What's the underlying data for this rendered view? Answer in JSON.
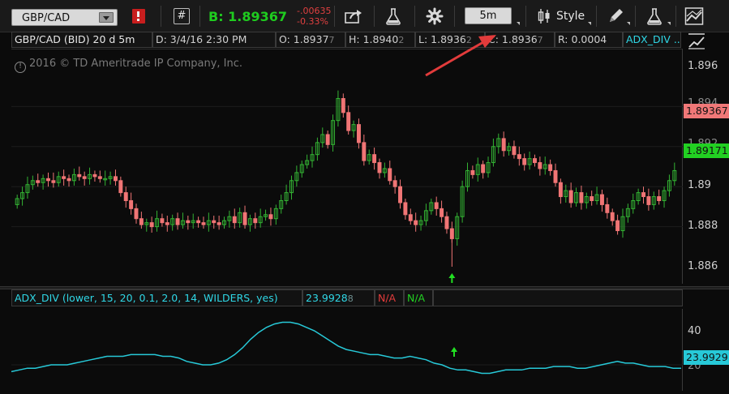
{
  "toolbar": {
    "symbol": "GBP/CAD",
    "bid": "B: 1.89367",
    "change_abs": "-.00635",
    "change_pct": "-0.33%",
    "timeframe": "5m",
    "style_label": "Style"
  },
  "infobar": {
    "title": "GBP/CAD (BID) 20 d 5m",
    "date": "D: 3/4/16 2:30 PM",
    "open": "O: 1.8937",
    "open_extra": "7",
    "high": "H: 1.8940",
    "high_extra": "2",
    "low": "L: 1.8936",
    "low_extra": "2",
    "close": "C: 1.8936",
    "close_extra": "7",
    "range": "R: 0.0004",
    "study": "ADX_DIV ..."
  },
  "upper_chart": {
    "copyright": "2016 © TD Ameritrade IP Company, Inc.",
    "y_ticks": [
      "1.896",
      "1.894",
      "1.892",
      "1.89",
      "1.888",
      "1.886"
    ],
    "price_tags": [
      {
        "label": "1.89367",
        "color": "#f07878"
      },
      {
        "label": "1.89171",
        "color": "#22d022"
      }
    ]
  },
  "lower_chart": {
    "study_label": "ADX_DIV (lower, 15, 20, 0.1, 2.0, 14, WILDERS, yes)",
    "study_value": "23.9928",
    "study_value_extra": "8",
    "na_red": "N/A",
    "na_green": "N/A",
    "y_ticks": [
      "40",
      "20"
    ],
    "value_tag": "23.9929"
  },
  "colors": {
    "bull": "#33b333",
    "bear": "#f07575",
    "adx_line": "#27c9d8",
    "arrow": "#22e022",
    "annotation_arrow": "#e23b3b"
  }
}
